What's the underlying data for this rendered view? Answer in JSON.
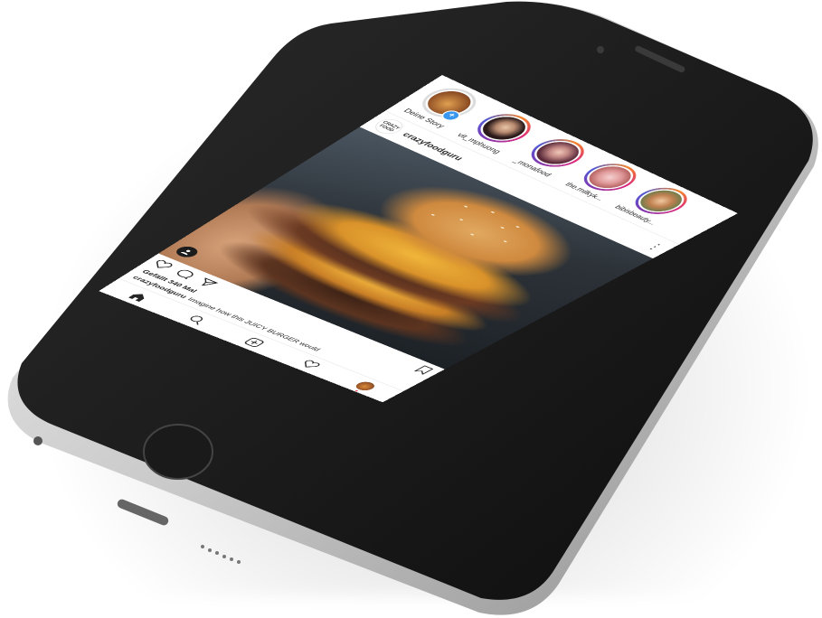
{
  "stories": [
    {
      "label": "Deine Story",
      "own": true,
      "avatar_color": "#c9873f"
    },
    {
      "label": "vit_mphuong",
      "own": false,
      "avatar_color": "#3a2a2a"
    },
    {
      "label": "_monafood",
      "own": false,
      "avatar_color": "#6b3b4a"
    },
    {
      "label": "the.milkyk...",
      "own": false,
      "avatar_color": "#d98c8c"
    },
    {
      "label": "bibisbeauty...",
      "own": false,
      "avatar_color": "#8a5a3a"
    }
  ],
  "post": {
    "username": "crazyfoodguru",
    "avatar_text": "CRAZY FOOD",
    "likes": "Gefällt 340 Mal",
    "caption_user": "crazyfoodguru",
    "caption_text": "Imagine how this JUICY BURGER would"
  },
  "icons": {
    "like": "heart-icon",
    "comment": "comment-icon",
    "share": "paper-plane-icon",
    "save": "bookmark-icon",
    "home": "home-icon",
    "search": "search-icon",
    "add": "add-post-icon",
    "activity": "heart-icon",
    "profile": "profile-icon",
    "more": "more-icon",
    "tag": "user-tag-icon"
  },
  "colors": {
    "story_ring_start": "#f58529",
    "story_ring_end": "#515bd4",
    "add_story_badge": "#3897f0",
    "notification_dot": "#ed4956"
  }
}
